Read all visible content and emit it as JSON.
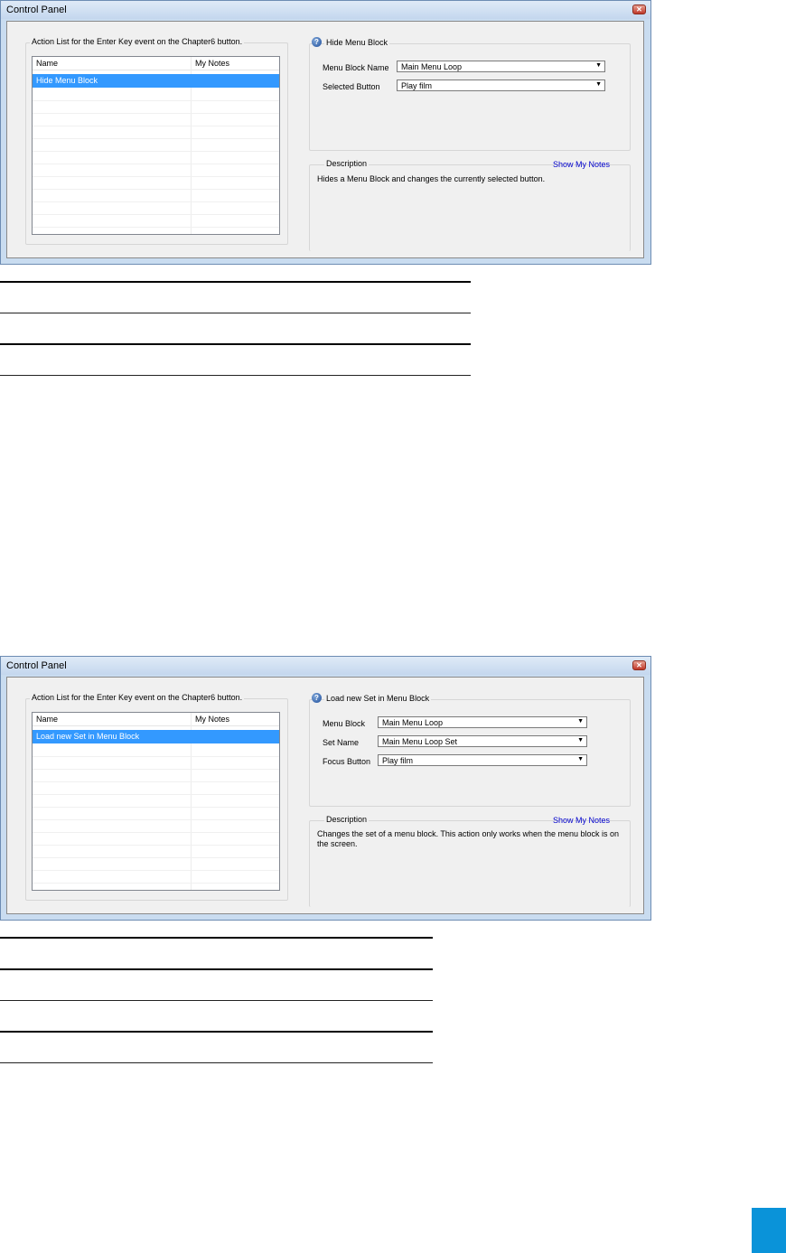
{
  "colors": {
    "selection": "#3399ff",
    "link": "#0000cc",
    "page_tab": "#0a93d9"
  },
  "window1": {
    "title": "Control Panel",
    "action_list_legend": "Action List for the Enter Key event on the Chapter6 button.",
    "columns": [
      "Name",
      "My Notes"
    ],
    "rows": [
      "Hide Menu Block"
    ],
    "selected_row": 0,
    "action_title": "Hide Menu Block",
    "fields": [
      {
        "label": "Menu Block Name",
        "value": "Main Menu Loop"
      },
      {
        "label": "Selected Button",
        "value": "Play film"
      }
    ],
    "description_legend": "Description",
    "show_notes": "Show My Notes",
    "description": "Hides a Menu Block and changes the currently selected button."
  },
  "window2": {
    "title": "Control Panel",
    "action_list_legend": "Action List for the Enter Key event on the Chapter6 button.",
    "columns": [
      "Name",
      "My Notes"
    ],
    "rows": [
      "Load new Set in Menu Block"
    ],
    "selected_row": 0,
    "action_title": "Load new Set in Menu Block",
    "fields": [
      {
        "label": "Menu Block",
        "value": "Main Menu Loop"
      },
      {
        "label": "Set Name",
        "value": "Main Menu Loop Set"
      },
      {
        "label": "Focus Button",
        "value": "Play film"
      }
    ],
    "description_legend": "Description",
    "show_notes": "Show My Notes",
    "description": "Changes the set of a menu block. This action only works when the menu block is on the screen."
  },
  "icons": {
    "help": "help-icon",
    "close": "close-icon",
    "dropdown": "chevron-down-icon"
  }
}
